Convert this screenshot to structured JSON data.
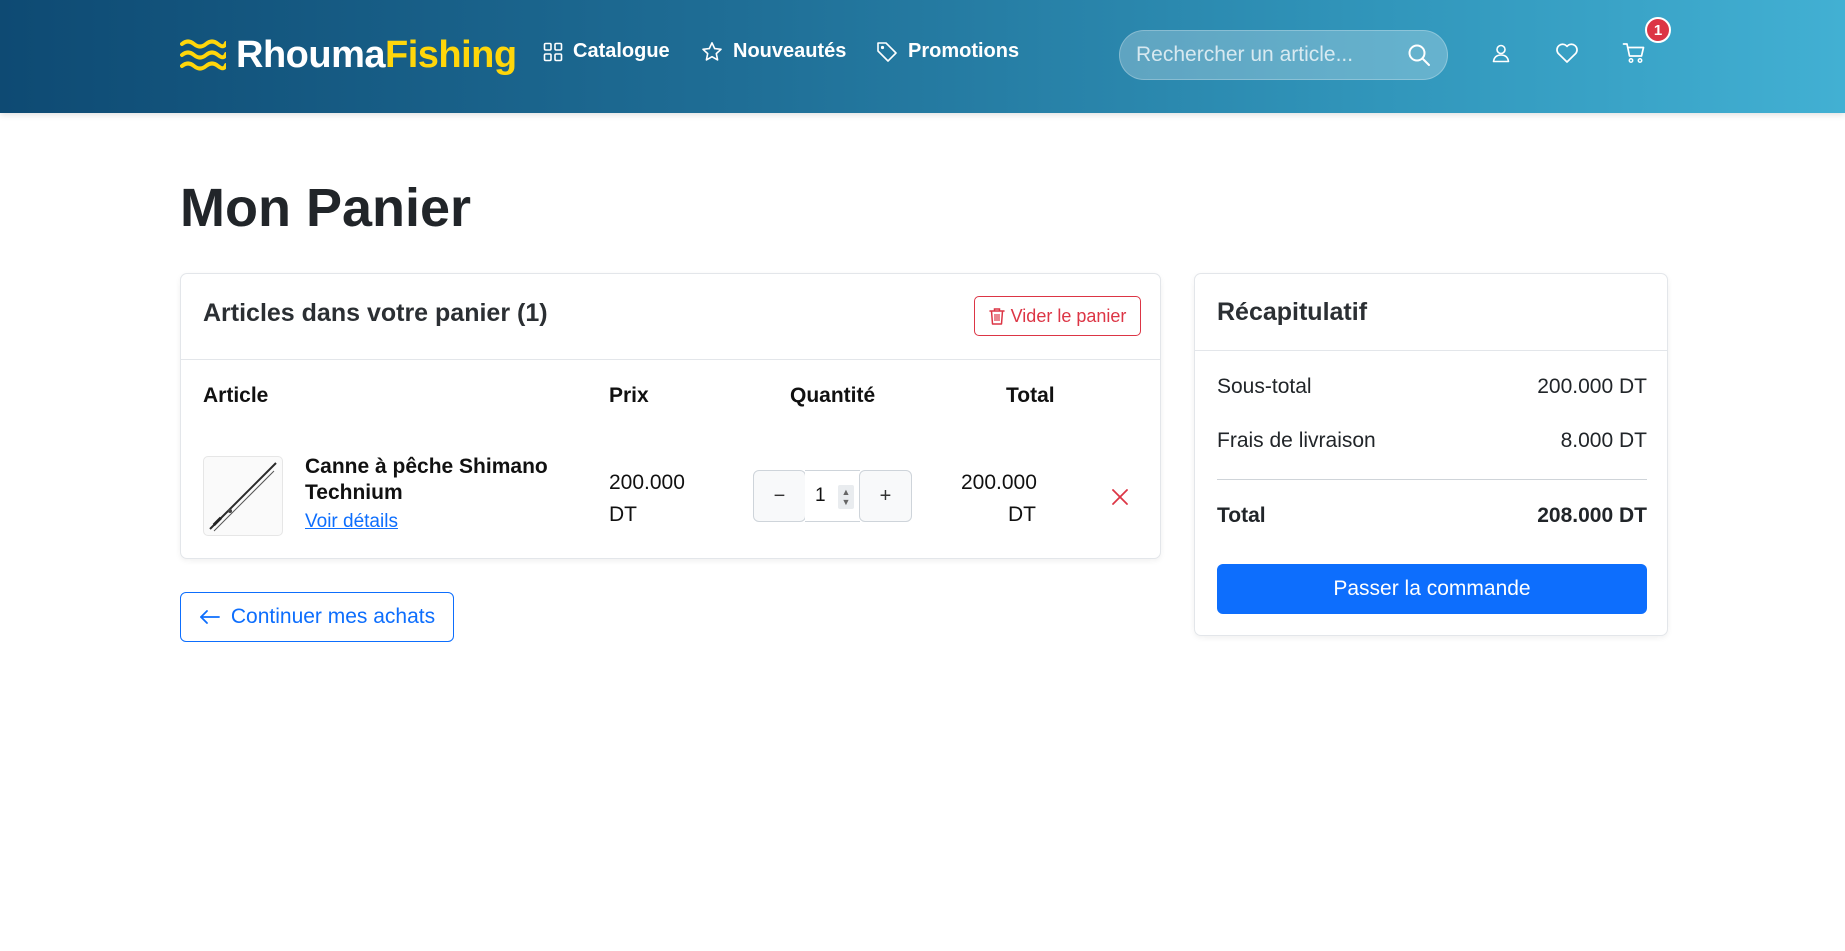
{
  "header": {
    "logo_part1": "Rhouma",
    "logo_part2": "Fishing",
    "nav": {
      "catalogue": "Catalogue",
      "nouveautes": "Nouveautés",
      "promotions": "Promotions"
    },
    "search_placeholder": "Rechercher un article...",
    "cart_count": "1",
    "icons": [
      "waves-icon",
      "grid-icon",
      "star-icon",
      "tag-icon",
      "search-icon",
      "user-icon",
      "heart-icon",
      "cart-icon"
    ]
  },
  "page_title": "Mon Panier",
  "cart": {
    "heading": "Articles dans votre panier (1)",
    "clear_label": "Vider le panier",
    "columns": {
      "article": "Article",
      "prix": "Prix",
      "quantite": "Quantité",
      "total": "Total"
    },
    "items": [
      {
        "name": "Canne à pêche Shimano Technium",
        "link_label": "Voir détails",
        "price": "200.000 DT",
        "quantity": "1",
        "total": "200.000 DT"
      }
    ],
    "continue_label": "Continuer mes achats"
  },
  "summary": {
    "title": "Récapitulatif",
    "subtotal_label": "Sous-total",
    "subtotal_value": "200.000 DT",
    "shipping_label": "Frais de livraison",
    "shipping_value": "8.000 DT",
    "total_label": "Total",
    "total_value": "208.000 DT",
    "checkout_label": "Passer la commande"
  },
  "colors": {
    "brand_yellow": "#ffd60a",
    "primary": "#0d6efd",
    "danger": "#dc3545",
    "header_start": "#0e4a73",
    "header_end": "#42b0d3"
  }
}
